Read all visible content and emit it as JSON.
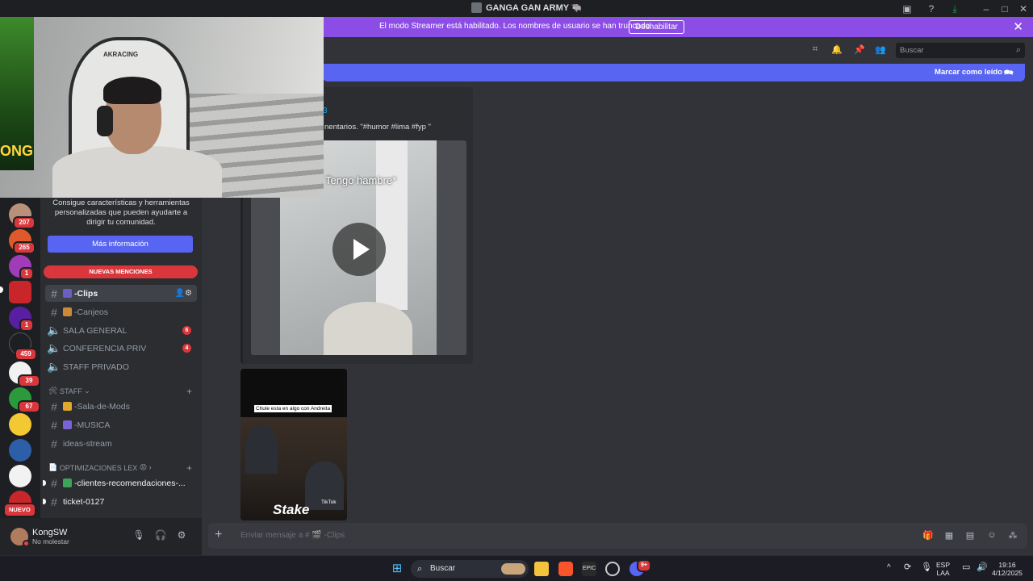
{
  "window": {
    "title": "GANGA GAN ARMY 🐃"
  },
  "streamer_banner": {
    "message": "El modo Streamer está habilitado. Los nombres de usuario se han truncado.",
    "button": "Deshabilitar"
  },
  "server_rail": {
    "badges": [
      "207",
      "265",
      "1",
      "1",
      "459",
      "39",
      "67"
    ],
    "new_label": "NUEVO"
  },
  "sidebar": {
    "promo_text": "Consigue características y herramientas personalizadas que pueden ayudarte a dirigir tu comunidad.",
    "promo_button": "Más información",
    "mentions_label": "NUEVAS MENCIONES",
    "channels": [
      {
        "name": "-Clips",
        "type": "text",
        "emoji": "🎬"
      },
      {
        "name": "-Canjeos",
        "type": "text",
        "emoji": "📦"
      },
      {
        "name": "SALA GENERAL",
        "type": "voice",
        "count": "6"
      },
      {
        "name": "CONFERENCIA PRIV",
        "type": "voice",
        "count": "4"
      },
      {
        "name": "STAFF PRIVADO",
        "type": "voice"
      }
    ],
    "category_staff": "STAFF",
    "staff_channels": [
      {
        "name": "-Sala-de-Mods",
        "emoji": "👑"
      },
      {
        "name": "-MUSICA",
        "emoji": "🎶"
      },
      {
        "name": "ideas-stream"
      }
    ],
    "category_opt": "OPTIMIZACIONES LEX",
    "opt_channels": [
      {
        "name": "-clientes-recomendaciones-...",
        "emoji": "✅"
      },
      {
        "name": "ticket-0127"
      }
    ]
  },
  "user": {
    "name": "KongSW",
    "status": "No molestar"
  },
  "header": {
    "search_placeholder": "Buscar"
  },
  "unread_bar": {
    "partial_text": "",
    "mark_read": "Marcar como leído"
  },
  "embed": {
    "author_partial": "3",
    "description": "nentarios. \"#humor #lima #fyp \"",
    "video_caption": "Tengo hambre*"
  },
  "second_video": {
    "caption": "Chule esta en algo con Andreita",
    "logo": "Stake",
    "tiktok": "TikTok"
  },
  "composer": {
    "placeholder": "Enviar mensaje a # 🎬 -Clips"
  },
  "webcam": {
    "chair_brand": "AKRACING",
    "side_text": "ONG"
  },
  "taskbar": {
    "search": "Buscar",
    "lang_top": "ESP",
    "lang_bottom": "LAA",
    "time": "19:16",
    "date": "4/12/2025",
    "notif": "9+"
  },
  "colors": {
    "streamer_banner": "#8c4de6",
    "blurple": "#5865f2",
    "mention_red": "#da373c"
  }
}
